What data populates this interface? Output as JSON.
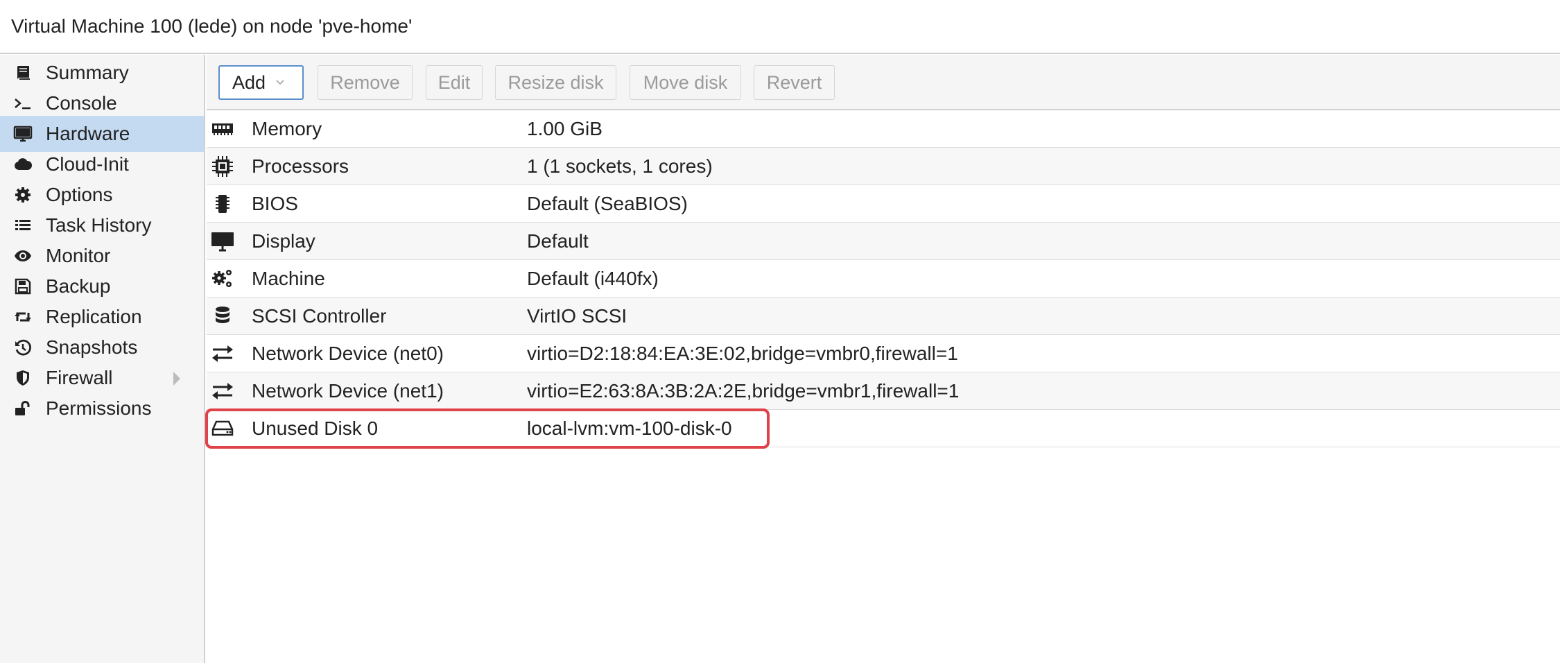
{
  "title": "Virtual Machine 100 (lede) on node 'pve-home'",
  "sidebar": {
    "items": [
      {
        "label": "Summary",
        "icon": "book-icon"
      },
      {
        "label": "Console",
        "icon": "terminal-icon"
      },
      {
        "label": "Hardware",
        "icon": "monitor-icon",
        "active": true
      },
      {
        "label": "Cloud-Init",
        "icon": "cloud-icon"
      },
      {
        "label": "Options",
        "icon": "gear-icon"
      },
      {
        "label": "Task History",
        "icon": "list-icon"
      },
      {
        "label": "Monitor",
        "icon": "eye-icon"
      },
      {
        "label": "Backup",
        "icon": "floppy-icon"
      },
      {
        "label": "Replication",
        "icon": "retweet-icon"
      },
      {
        "label": "Snapshots",
        "icon": "history-icon"
      },
      {
        "label": "Firewall",
        "icon": "shield-icon"
      },
      {
        "label": "Permissions",
        "icon": "unlock-icon"
      }
    ]
  },
  "toolbar": {
    "add": "Add",
    "remove": "Remove",
    "edit": "Edit",
    "resize": "Resize disk",
    "move": "Move disk",
    "revert": "Revert"
  },
  "hardware": [
    {
      "name": "Memory",
      "value": "1.00 GiB",
      "icon": "memory-icon"
    },
    {
      "name": "Processors",
      "value": "1 (1 sockets, 1 cores)",
      "icon": "cpu-icon"
    },
    {
      "name": "BIOS",
      "value": "Default (SeaBIOS)",
      "icon": "microchip-icon"
    },
    {
      "name": "Display",
      "value": "Default",
      "icon": "display-icon"
    },
    {
      "name": "Machine",
      "value": "Default (i440fx)",
      "icon": "gears-icon"
    },
    {
      "name": "SCSI Controller",
      "value": "VirtIO SCSI",
      "icon": "database-icon"
    },
    {
      "name": "Network Device (net0)",
      "value": "virtio=D2:18:84:EA:3E:02,bridge=vmbr0,firewall=1",
      "icon": "exchange-icon"
    },
    {
      "name": "Network Device (net1)",
      "value": "virtio=E2:63:8A:3B:2A:2E,bridge=vmbr1,firewall=1",
      "icon": "exchange-icon"
    },
    {
      "name": "Unused Disk 0",
      "value": "local-lvm:vm-100-disk-0",
      "icon": "hdd-icon",
      "highlighted": true
    }
  ],
  "colors": {
    "active_nav": "#c4daf0",
    "highlight_border": "#e0424a",
    "add_border": "#5b8fc9"
  }
}
